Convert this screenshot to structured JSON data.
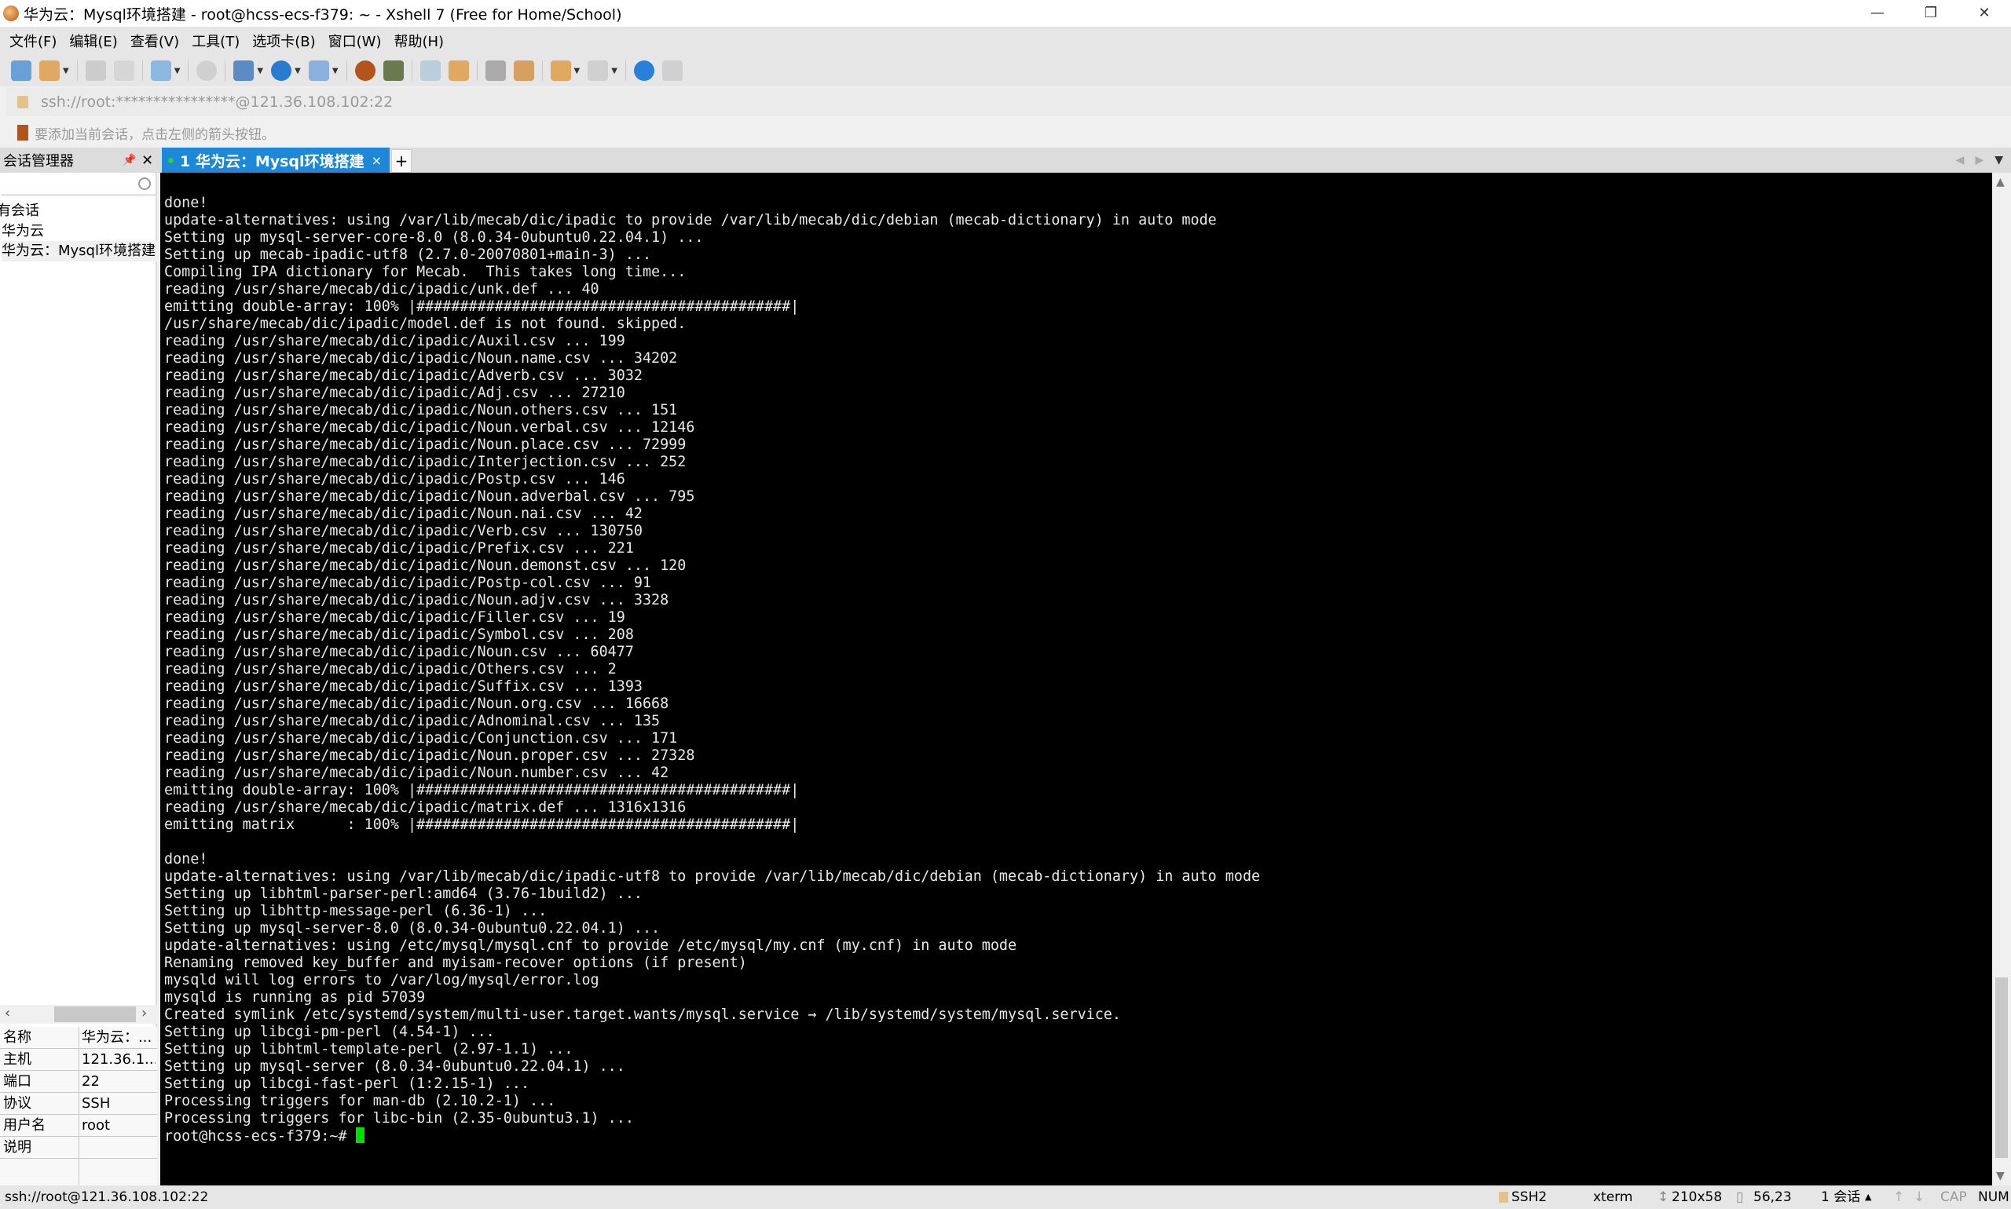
{
  "window": {
    "title": "华为云：Mysql环境搭建 - root@hcss-ecs-f379: ~ - Xshell 7 (Free for Home/School)",
    "minimize": "—",
    "restore": "❐",
    "close": "✕"
  },
  "menu": [
    "文件(F)",
    "编辑(E)",
    "查看(V)",
    "工具(T)",
    "选项卡(B)",
    "窗口(W)",
    "帮助(H)"
  ],
  "address": "ssh://root:****************@121.36.108.102:22",
  "hint": "要添加当前会话，点击左侧的箭头按钮。",
  "session_manager": {
    "title": "会话管理器",
    "pin": "📌",
    "close": "✕",
    "tree": [
      "所有会话",
      "华为云",
      "华为云：Mysql环境搭建"
    ],
    "props": [
      {
        "k": "名称",
        "v": "华为云：..."
      },
      {
        "k": "主机",
        "v": "121.36.1..."
      },
      {
        "k": "端口",
        "v": "22"
      },
      {
        "k": "协议",
        "v": "SSH"
      },
      {
        "k": "用户名",
        "v": "root"
      },
      {
        "k": "说明",
        "v": ""
      }
    ]
  },
  "tab": {
    "label": "1 华为云：Mysql环境搭建",
    "close": "×",
    "add": "+"
  },
  "terminal": {
    "lines": [
      "done!",
      "update-alternatives: using /var/lib/mecab/dic/ipadic to provide /var/lib/mecab/dic/debian (mecab-dictionary) in auto mode",
      "Setting up mysql-server-core-8.0 (8.0.34-0ubuntu0.22.04.1) ...",
      "Setting up mecab-ipadic-utf8 (2.7.0-20070801+main-3) ...",
      "Compiling IPA dictionary for Mecab.  This takes long time...",
      "reading /usr/share/mecab/dic/ipadic/unk.def ... 40",
      "emitting double-array: 100% |###########################################|",
      "/usr/share/mecab/dic/ipadic/model.def is not found. skipped.",
      "reading /usr/share/mecab/dic/ipadic/Auxil.csv ... 199",
      "reading /usr/share/mecab/dic/ipadic/Noun.name.csv ... 34202",
      "reading /usr/share/mecab/dic/ipadic/Adverb.csv ... 3032",
      "reading /usr/share/mecab/dic/ipadic/Adj.csv ... 27210",
      "reading /usr/share/mecab/dic/ipadic/Noun.others.csv ... 151",
      "reading /usr/share/mecab/dic/ipadic/Noun.verbal.csv ... 12146",
      "reading /usr/share/mecab/dic/ipadic/Noun.place.csv ... 72999",
      "reading /usr/share/mecab/dic/ipadic/Interjection.csv ... 252",
      "reading /usr/share/mecab/dic/ipadic/Postp.csv ... 146",
      "reading /usr/share/mecab/dic/ipadic/Noun.adverbal.csv ... 795",
      "reading /usr/share/mecab/dic/ipadic/Noun.nai.csv ... 42",
      "reading /usr/share/mecab/dic/ipadic/Verb.csv ... 130750",
      "reading /usr/share/mecab/dic/ipadic/Prefix.csv ... 221",
      "reading /usr/share/mecab/dic/ipadic/Noun.demonst.csv ... 120",
      "reading /usr/share/mecab/dic/ipadic/Postp-col.csv ... 91",
      "reading /usr/share/mecab/dic/ipadic/Noun.adjv.csv ... 3328",
      "reading /usr/share/mecab/dic/ipadic/Filler.csv ... 19",
      "reading /usr/share/mecab/dic/ipadic/Symbol.csv ... 208",
      "reading /usr/share/mecab/dic/ipadic/Noun.csv ... 60477",
      "reading /usr/share/mecab/dic/ipadic/Others.csv ... 2",
      "reading /usr/share/mecab/dic/ipadic/Suffix.csv ... 1393",
      "reading /usr/share/mecab/dic/ipadic/Noun.org.csv ... 16668",
      "reading /usr/share/mecab/dic/ipadic/Adnominal.csv ... 135",
      "reading /usr/share/mecab/dic/ipadic/Conjunction.csv ... 171",
      "reading /usr/share/mecab/dic/ipadic/Noun.proper.csv ... 27328",
      "reading /usr/share/mecab/dic/ipadic/Noun.number.csv ... 42",
      "emitting double-array: 100% |###########################################|",
      "reading /usr/share/mecab/dic/ipadic/matrix.def ... 1316x1316",
      "emitting matrix      : 100% |###########################################|",
      "",
      "done!",
      "update-alternatives: using /var/lib/mecab/dic/ipadic-utf8 to provide /var/lib/mecab/dic/debian (mecab-dictionary) in auto mode",
      "Setting up libhtml-parser-perl:amd64 (3.76-1build2) ...",
      "Setting up libhttp-message-perl (6.36-1) ...",
      "Setting up mysql-server-8.0 (8.0.34-0ubuntu0.22.04.1) ...",
      "update-alternatives: using /etc/mysql/mysql.cnf to provide /etc/mysql/my.cnf (my.cnf) in auto mode",
      "Renaming removed key_buffer and myisam-recover options (if present)",
      "mysqld will log errors to /var/log/mysql/error.log",
      "mysqld is running as pid 57039",
      "Created symlink /etc/systemd/system/multi-user.target.wants/mysql.service → /lib/systemd/system/mysql.service.",
      "Setting up libcgi-pm-perl (4.54-1) ...",
      "Setting up libhtml-template-perl (2.97-1.1) ...",
      "Setting up mysql-server (8.0.34-0ubuntu0.22.04.1) ...",
      "Setting up libcgi-fast-perl (1:2.15-1) ...",
      "Processing triggers for man-db (2.10.2-1) ...",
      "Processing triggers for libc-bin (2.35-0ubuntu3.1) ..."
    ],
    "prompt": "root@hcss-ecs-f379:~# "
  },
  "status": {
    "left": "ssh://root@121.36.108.102:22",
    "protocol": "SSH2",
    "term": "xterm",
    "size": "210x58",
    "cursor": "56,23",
    "sessions": "1 会话",
    "cap": "CAP",
    "num": "NUM"
  },
  "colors": {
    "accent": "#1e88d8",
    "cursor": "#00e000"
  }
}
